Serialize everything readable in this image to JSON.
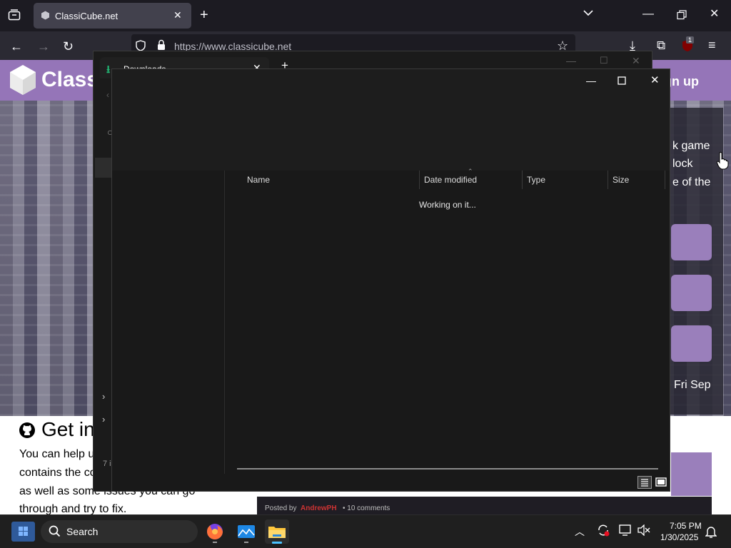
{
  "browser": {
    "tab_title": "ClassiCube.net",
    "url": "https://www.classicube.net",
    "extension_badge": "1"
  },
  "webpage": {
    "logo_text": "Classi",
    "signup_label": "gn up",
    "side_lines": [
      "k game",
      "lock",
      "e of the"
    ],
    "date_text": "Fri Sep",
    "heading": "Get in",
    "body_lines": [
      "You can help u",
      "contains the comp",
      "as well as some issues you can go",
      "through and try to fix."
    ],
    "blog_posted_by": "Posted by",
    "blog_author": "AndrewPH",
    "blog_comments": "• 10 comments"
  },
  "ghost_window": {
    "title": "Downloads",
    "left_label": "7 i"
  },
  "explorer": {
    "columns": [
      "Name",
      "Date modified",
      "Type",
      "Size"
    ],
    "status": "Working on it..."
  },
  "taskbar": {
    "search_placeholder": "Search",
    "time": "7:05 PM",
    "date": "1/30/2025"
  },
  "colors": {
    "brand_purple": "#9575b8",
    "browser_dark": "#1c1b22",
    "explorer_bg": "#191919"
  }
}
